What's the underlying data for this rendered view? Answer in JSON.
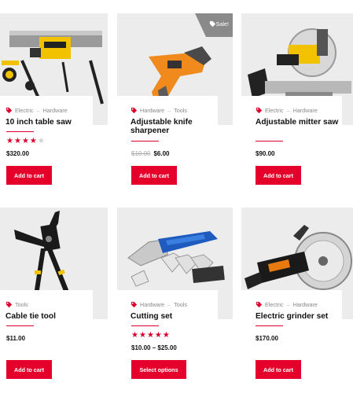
{
  "products": [
    {
      "title": "10 inch table saw",
      "categories": [
        "Electric",
        "Hardware"
      ],
      "rating": 4,
      "rating_max": 5,
      "price": "$320.00",
      "button": "Add to cart",
      "image_icon": "table-saw-icon"
    },
    {
      "title": "Adjustable knife sharpener",
      "categories": [
        "Hardware",
        "Tools"
      ],
      "sale_badge": "Sale!",
      "old_price": "$10.00",
      "price": "$6.00",
      "button": "Add to cart",
      "image_icon": "knife-sharpener-icon"
    },
    {
      "title": "Adjustable mitter saw",
      "categories": [
        "Electric",
        "Hardware"
      ],
      "price": "$90.00",
      "button": "Add to cart",
      "image_icon": "miter-saw-icon"
    },
    {
      "title": "Cable tie tool",
      "categories": [
        "Tools"
      ],
      "price": "$11.00",
      "button": "Add to cart",
      "image_icon": "cable-tie-tool-icon"
    },
    {
      "title": "Cutting set",
      "categories": [
        "Hardware",
        "Tools"
      ],
      "rating": 5,
      "rating_max": 5,
      "price": "$10.00 – $25.00",
      "button": "Select options",
      "image_icon": "cutting-set-icon"
    },
    {
      "title": "Electric grinder set",
      "categories": [
        "Electric",
        "Hardware"
      ],
      "price": "$170.00",
      "button": "Add to cart",
      "image_icon": "grinder-icon"
    }
  ],
  "colors": {
    "accent": "#e4002b",
    "image_bg": "#ececec"
  }
}
